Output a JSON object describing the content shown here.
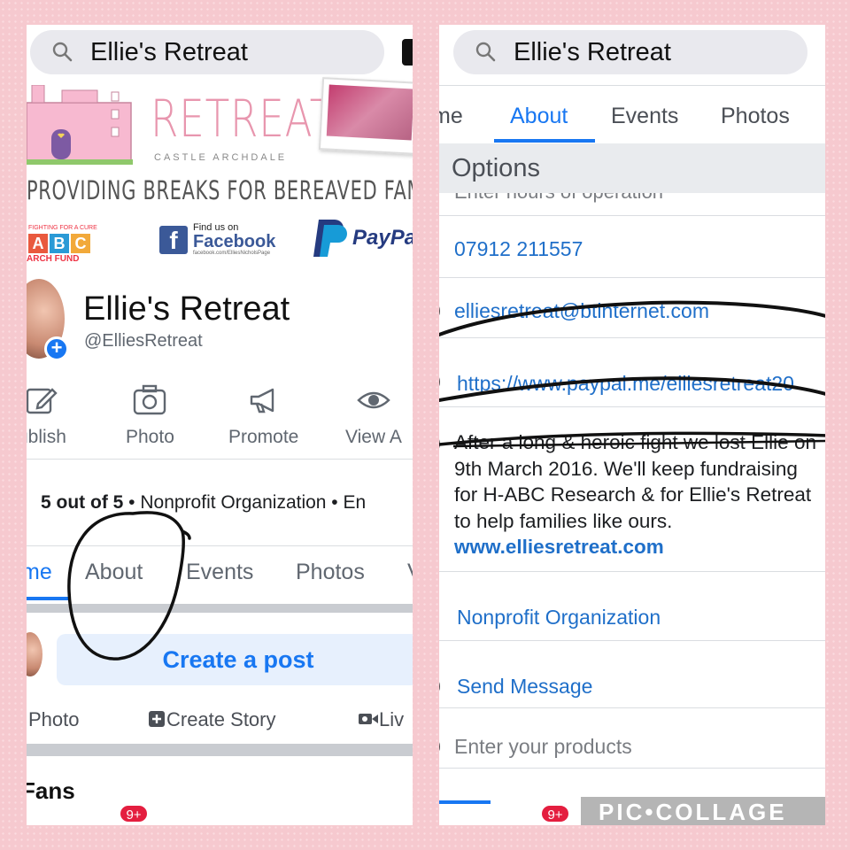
{
  "left": {
    "search_text": "Ellie's Retreat",
    "cover": {
      "retreat_word": "RETREAT",
      "subtitle": "CASTLE ARCHDALE",
      "tagline": "PROVIDING BREAKS FOR BEREAVED FAMILIES",
      "abc_top": "FIGHTING FOR A CURE",
      "abc_letters": [
        "A",
        "B",
        "C"
      ],
      "abc_bottom": "ARCH FUND",
      "fb_find": "Find us on",
      "fb_word": "Facebook",
      "fb_url": "facebook.com/ElliesNicholsPage",
      "paypal_word": "PayPal"
    },
    "profile": {
      "name": "Ellie's Retreat",
      "handle": "@ElliesRetreat"
    },
    "actions": [
      "ublish",
      "Photo",
      "Promote",
      "View A"
    ],
    "rating": {
      "score": "5 out of 5",
      "rest": " • Nonprofit Organization • En"
    },
    "tabs": [
      "me",
      "About",
      "Events",
      "Photos",
      "V"
    ],
    "create_post": "Create a post",
    "post_options": [
      "Photo",
      "Create Story",
      "Liv"
    ],
    "section_title": "Fans",
    "badge": "9+"
  },
  "right": {
    "search_text": "Ellie's Retreat",
    "tabs": [
      "me",
      "About",
      "Events",
      "Photos"
    ],
    "active_tab": "About",
    "options_label": "Options",
    "hours_placeholder": "Enter hours of operation",
    "phone": "07912 211557",
    "email": "elliesretreat@btinternet.com",
    "website": "https://www.paypal.me/elliesretreat20",
    "about": {
      "text": "After a long & heroic fight we lost Ellie on 9th March 2016.  We'll keep fundraising for H-ABC Research & for Ellie's Retreat to help families like ours. ",
      "link": "www.elliesretreat.com"
    },
    "category": "Nonprofit Organization",
    "send_message": "Send Message",
    "products_placeholder": "Enter your products",
    "badge": "9+"
  },
  "watermark": "PIC•COLLAGE",
  "colors": {
    "facebook_blue": "#1877f2",
    "link_blue": "#1f6fc9",
    "cover_pink": "#e896ae",
    "background_pink": "#f6c9cf"
  }
}
